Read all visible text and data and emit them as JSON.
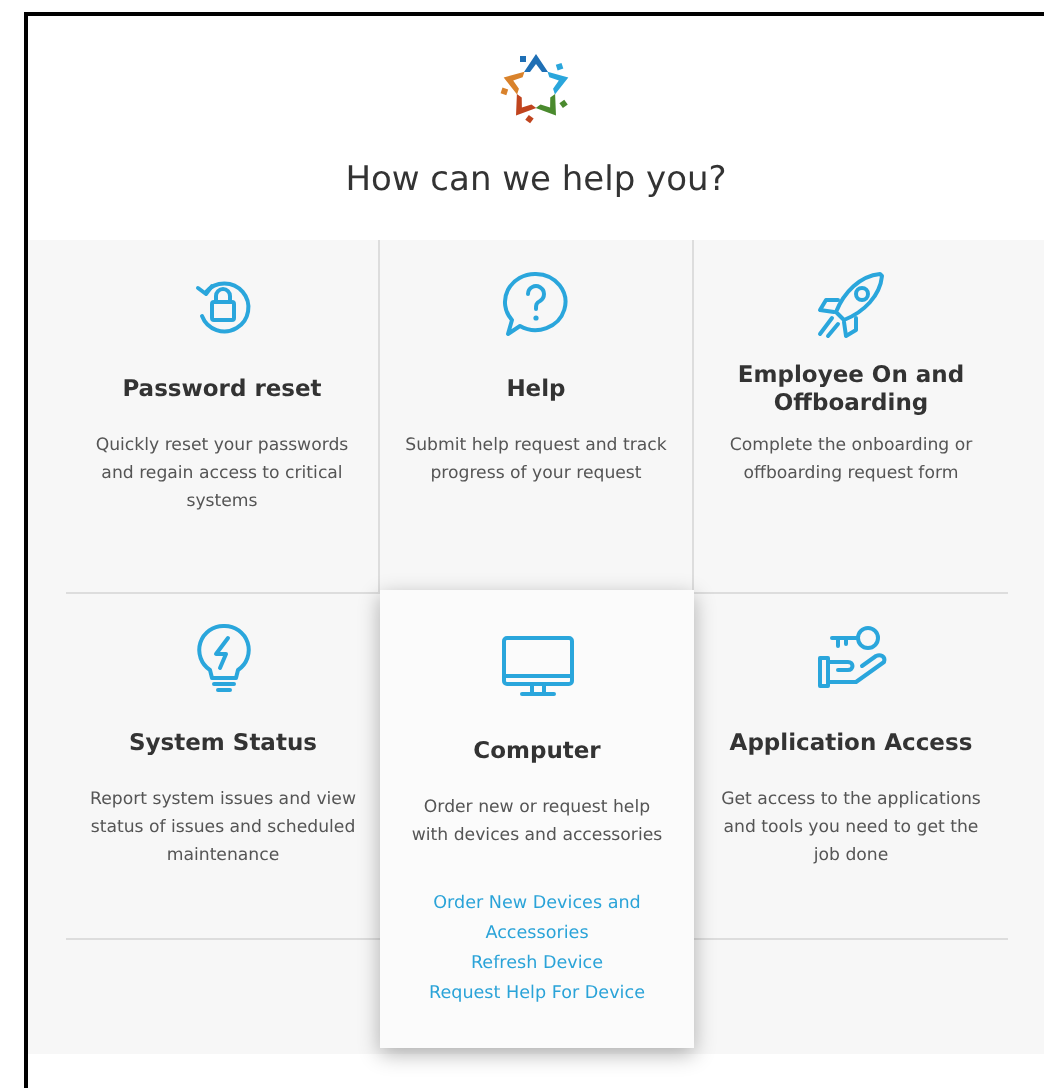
{
  "heading": "How can we help you?",
  "tiles": [
    {
      "title": "Password reset",
      "description": "Quickly reset your passwords and regain access to critical systems",
      "highlighted": false
    },
    {
      "title": "Help",
      "description": "Submit help request and track progress of your request",
      "highlighted": false
    },
    {
      "title": "Employee On and Offboarding",
      "description": "Complete the onboarding or offboarding request form",
      "highlighted": false
    },
    {
      "title": "System Status",
      "description": "Report system issues and view status of issues and scheduled maintenance",
      "highlighted": false
    },
    {
      "title": "Computer",
      "description": "Order new or request help with devices and accessories",
      "highlighted": true,
      "links": [
        "Order New Devices and Accessories",
        "Refresh Device",
        "Request Help For Device"
      ]
    },
    {
      "title": "Application Access",
      "description": "Get access to the applications and tools you need to get the job done",
      "highlighted": false
    }
  ]
}
